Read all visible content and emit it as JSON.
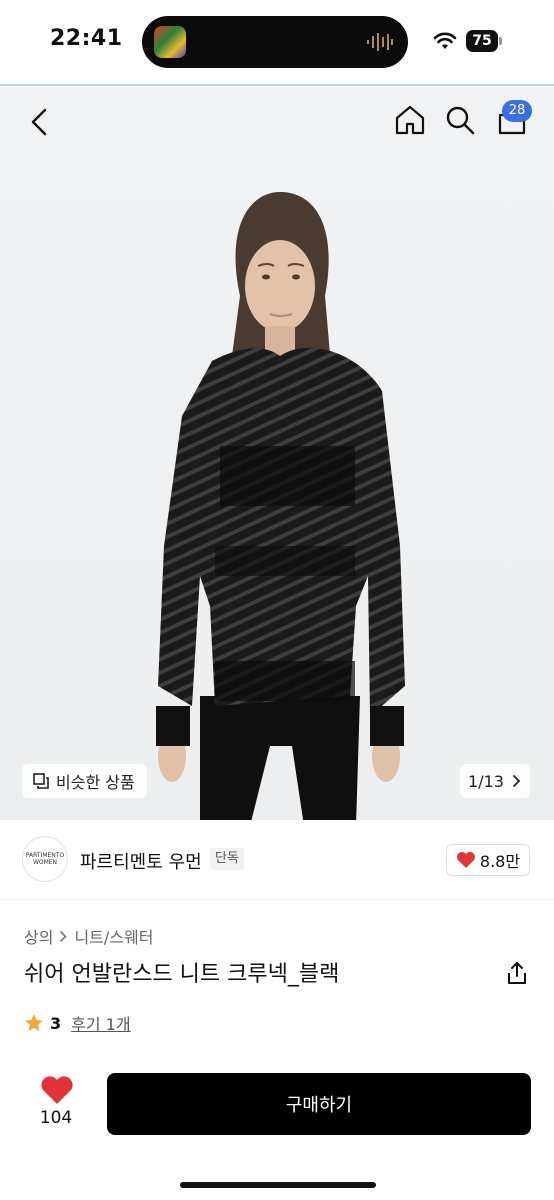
{
  "status_bar": {
    "time": "22:41",
    "battery": "75",
    "icons": [
      "now-playing-art-icon",
      "audio-wave-icon",
      "wifi-icon",
      "battery-icon"
    ]
  },
  "nav": {
    "icons": [
      "back-arrow-icon",
      "home-icon",
      "search-icon",
      "shopping-bag-icon"
    ],
    "cart_count": "28"
  },
  "gallery": {
    "similar_label": "비슷한 상품",
    "page_counter": "1/13"
  },
  "brand": {
    "logo_line1": "PARTIMENTO",
    "logo_line2": "WOMEN",
    "name": "파르티멘토 우먼",
    "tag": "단독",
    "likes": "8.8만"
  },
  "product": {
    "breadcrumb": [
      "상의",
      "니트/스웨터"
    ],
    "title": "쉬어 언발란스드 니트 크루넥_블랙",
    "rating": "3",
    "review_link": "후기 1개"
  },
  "bottom_bar": {
    "wish_count": "104",
    "buy_label": "구매하기"
  },
  "colors": {
    "accent_heart": "#e0343a",
    "badge_blue": "#3b6fe0",
    "star": "#f2a73b",
    "buy_button": "#000000"
  }
}
